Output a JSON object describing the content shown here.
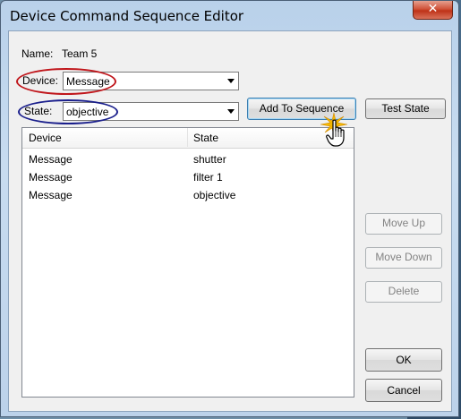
{
  "window": {
    "title": "Device Command Sequence Editor",
    "close_glyph": "✕"
  },
  "name": {
    "label": "Name:",
    "value": "Team 5"
  },
  "device": {
    "label": "Device:",
    "value": "Message"
  },
  "state": {
    "label": "State:",
    "value": "objective"
  },
  "buttons": {
    "add_to_sequence": "Add To Sequence",
    "test_state": "Test State",
    "move_up": "Move Up",
    "move_down": "Move Down",
    "delete": "Delete",
    "ok": "OK",
    "cancel": "Cancel"
  },
  "table": {
    "columns": [
      "Device",
      "State"
    ],
    "rows": [
      [
        "Message",
        "shutter"
      ],
      [
        "Message",
        "filter 1"
      ],
      [
        "Message",
        "objective"
      ]
    ]
  },
  "colors": {
    "device_highlight": "#c0161b",
    "state_highlight": "#1a1f8c",
    "sparkle": "#f5b800"
  },
  "icons": [
    "close-icon",
    "dropdown-arrow-icon",
    "hand-cursor-icon",
    "click-sparkle-icon"
  ]
}
